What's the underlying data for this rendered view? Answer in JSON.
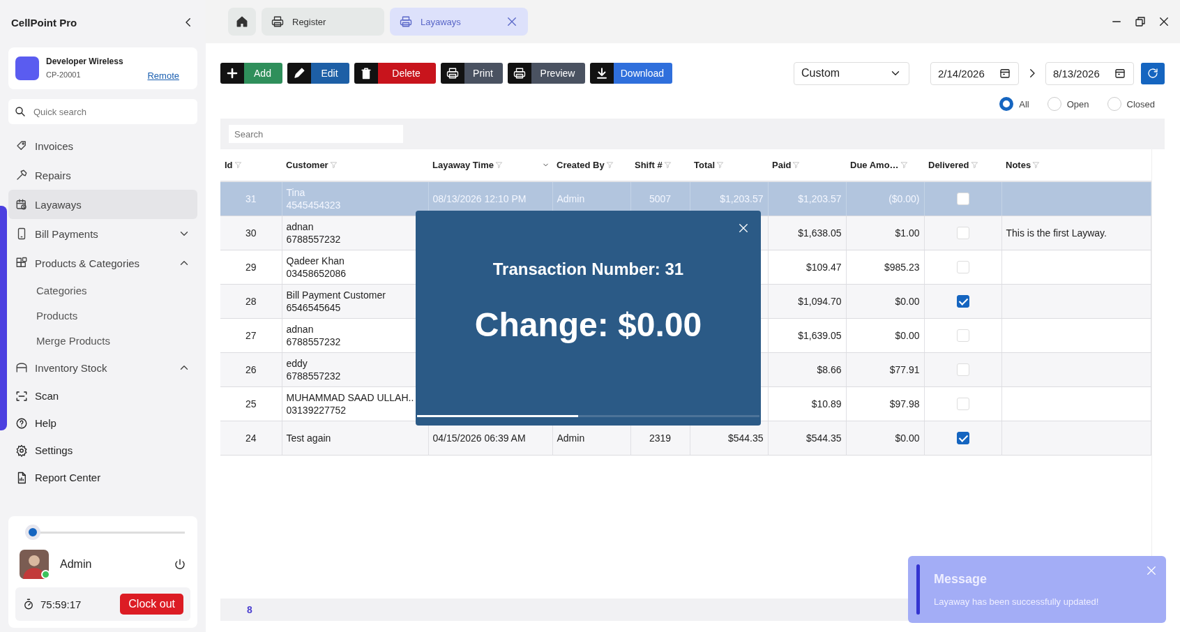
{
  "app": {
    "title": "CellPoint Pro"
  },
  "store": {
    "name": "Developer Wireless",
    "code": "CP-20001",
    "link": "Remote"
  },
  "quick_search": {
    "placeholder": "Quick search"
  },
  "nav": [
    {
      "label": "Invoices",
      "selected": false
    },
    {
      "label": "Repairs",
      "selected": false
    },
    {
      "label": "Layaways",
      "selected": true
    },
    {
      "label": "Bill Payments",
      "selected": false,
      "expanded": false
    },
    {
      "label": "Products & Categories",
      "selected": false,
      "expanded": true,
      "children": [
        {
          "label": "Categories",
          "selected": false
        },
        {
          "label": "Products",
          "selected": false
        },
        {
          "label": "Merge Products",
          "selected": false
        }
      ]
    },
    {
      "label": "Inventory Stock",
      "selected": false,
      "expanded": true
    }
  ],
  "nav_bottom": [
    {
      "label": "Scan",
      "selected": false
    },
    {
      "label": "Help",
      "selected": false
    },
    {
      "label": "Settings",
      "selected": false
    },
    {
      "label": "Report Center",
      "selected": false
    }
  ],
  "user": {
    "slider": {
      "level": 0
    },
    "name": "Admin",
    "online": true,
    "timer": "75:59:17",
    "clock_out": "Clock out"
  },
  "tabs": [
    {
      "kind": "home",
      "selected": false
    },
    {
      "kind": "page",
      "label": "Register",
      "selected": false,
      "closable": false
    },
    {
      "kind": "page",
      "label": "Layaways",
      "selected": true,
      "closable": true
    }
  ],
  "toolbar": [
    {
      "label": "Add",
      "color": "#2f8f5b"
    },
    {
      "label": "Edit",
      "color": "#1d5fa6"
    },
    {
      "label": "Delete",
      "color": "#c8141c"
    },
    {
      "label": "Print",
      "color": "#4a5261"
    },
    {
      "label": "Preview",
      "color": "#4a5261"
    },
    {
      "label": "Download",
      "color": "#2f6fdc"
    }
  ],
  "period": {
    "value": "Custom"
  },
  "date_from": "2/14/2026",
  "date_to": "8/13/2026",
  "status_filter": [
    {
      "label": "All",
      "selected": true
    },
    {
      "label": "Open",
      "selected": false
    },
    {
      "label": "Closed",
      "selected": false
    }
  ],
  "table": {
    "search": {
      "placeholder": "Search"
    },
    "columns": [
      {
        "label": "Id",
        "sorted": false
      },
      {
        "label": "Customer",
        "sorted": false
      },
      {
        "label": "Layaway Time",
        "sorted": true
      },
      {
        "label": "Created By",
        "sorted": false
      },
      {
        "label": "Shift #",
        "sorted": false
      },
      {
        "label": "Total",
        "sorted": false
      },
      {
        "label": "Paid",
        "sorted": false
      },
      {
        "label": "Due Amo…",
        "sorted": false
      },
      {
        "label": "Delivered",
        "sorted": false
      },
      {
        "label": "Notes",
        "sorted": false
      }
    ],
    "rows": [
      {
        "id": "31",
        "customer": "Tina",
        "phone": "4545454323",
        "layaway_time": "08/13/2026 12:10 PM",
        "created_by": "Admin",
        "shift": "5007",
        "total": "$1,203.57",
        "paid": "$1,203.57",
        "due": "($0.00)",
        "delivered": false,
        "selected": true
      },
      {
        "id": "30",
        "customer": "adnan",
        "phone": "6788557232",
        "paid": "$1,638.05",
        "due": "$1.00",
        "delivered": false,
        "notes": "This is the first Layway.",
        "selected": false
      },
      {
        "id": "29",
        "customer": "Qadeer Khan",
        "phone": "03458652086",
        "paid": "$109.47",
        "due": "$985.23",
        "delivered": false,
        "selected": false
      },
      {
        "id": "28",
        "customer": "Bill Payment Customer",
        "phone": "6546545645",
        "paid": "$1,094.70",
        "due": "$0.00",
        "delivered": true,
        "selected": false
      },
      {
        "id": "27",
        "customer": "adnan",
        "phone": "6788557232",
        "paid": "$1,639.05",
        "due": "$0.00",
        "delivered": false,
        "selected": false
      },
      {
        "id": "26",
        "customer": "eddy",
        "phone": "6788557232",
        "paid": "$8.66",
        "due": "$77.91",
        "delivered": false,
        "selected": false
      },
      {
        "id": "25",
        "customer": "MUHAMMAD SAAD ULLAH..",
        "phone": "03139227752",
        "paid": "$10.89",
        "due": "$97.98",
        "delivered": false,
        "selected": false
      },
      {
        "id": "24",
        "customer": "Test again",
        "layaway_time": "04/15/2026 06:39 AM",
        "created_by": "Admin",
        "shift": "2319",
        "total": "$544.35",
        "paid": "$544.35",
        "due": "$0.00",
        "delivered": true,
        "selected": false
      }
    ],
    "footer": {
      "count": "8"
    }
  },
  "modal": {
    "title": "Transaction Number: 31",
    "change": "Change: $0.00",
    "level": 0.47
  },
  "toast": {
    "title": "Message",
    "text": "Layaway has been successfully updated!"
  }
}
